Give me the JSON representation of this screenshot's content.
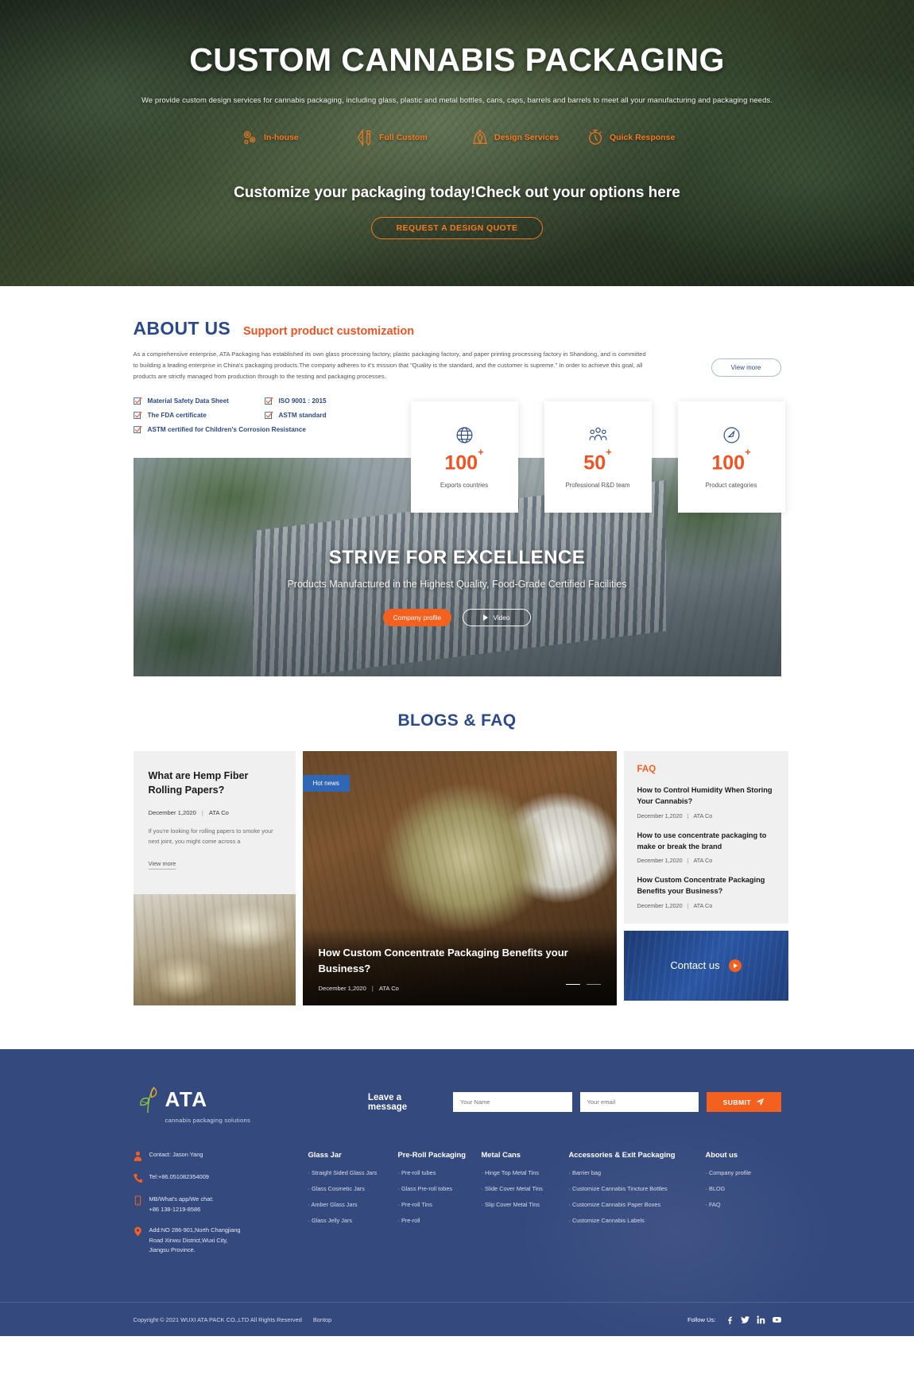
{
  "hero": {
    "title": "CUSTOM CANNABIS PACKAGING",
    "subtitle": "We provide custom design services for cannabis packaging, including glass, plastic and metal bottles, cans, caps, barrels and barrels to meet all your manufacturing and packaging needs.",
    "features": [
      {
        "icon": "gears-icon",
        "label": "In-house"
      },
      {
        "icon": "pencil-ruler-icon",
        "label": "Full Custom"
      },
      {
        "icon": "pen-nib-icon",
        "label": "Design Services"
      },
      {
        "icon": "stopwatch-icon",
        "label": "Quick Response"
      }
    ],
    "cta_title": "Customize your packaging today!Check out your options here",
    "cta_button": "REQUEST A DESIGN QUOTE"
  },
  "about": {
    "title": "ABOUT US",
    "kicker": "Support product customization",
    "paragraph": "As a comprehensive enterprise, ATA Packaging has established its own glass processing factory, plastic packaging factory, and paper printing processing factory in Shandong, and is committed to building a leading enterprise in China's packaging products.The company adheres to it's mission that \"Quality is the standard, and the customer is supreme.\"  In order to achieve this goal, all products are strictly managed from production through to the testing and packaging processes.",
    "view_more": "View more",
    "certs": [
      "Material Safety Data Sheet",
      "ISO 9001 : 2015",
      "The FDA certificate",
      "ASTM standard",
      "ASTM certified for Children's Corrosion Resistance"
    ],
    "stats": [
      {
        "icon": "globe-icon",
        "number": "100",
        "sup": "+",
        "label": "Exports countries"
      },
      {
        "icon": "people-icon",
        "number": "50",
        "sup": "+",
        "label": "Professional R&D team"
      },
      {
        "icon": "tag-icon",
        "number": "100",
        "sup": "+",
        "label": "Product categories"
      }
    ]
  },
  "banner": {
    "title": "STRIVE FOR EXCELLENCE",
    "subtitle": "Products Manufactured in the Highest Quality, Food-Grade Certified Facilities",
    "profile_button": "Company profile",
    "video_button": "Video"
  },
  "blogs": {
    "section_title": "BLOGS & FAQ",
    "left": {
      "title": "What are Hemp Fiber Rolling Papers?",
      "date": "December 1,2020",
      "author": "ATA Co",
      "excerpt": "If you're looking for rolling papers to smoke your next joint, you might come across a",
      "view_more": "View more"
    },
    "center": {
      "badge": "Hot news",
      "title": "How Custom Concentrate Packaging Benefits your Business?",
      "date": "December 1,2020",
      "author": "ATA Co"
    },
    "faq": {
      "title": "FAQ",
      "items": [
        {
          "question": "How to Control Humidity When Storing Your Cannabis?",
          "date": "December 1,2020",
          "author": "ATA Co"
        },
        {
          "question": "How to use concentrate packaging to make or break the brand",
          "date": "December 1,2020",
          "author": "ATA Co"
        },
        {
          "question": "How Custom Concentrate Packaging Benefits your Business?",
          "date": "December 1,2020",
          "author": "ATA Co"
        }
      ]
    },
    "contact_cta": "Contact us"
  },
  "footer": {
    "logo_text": "ATA",
    "logo_tagline": "cannabis  packaging solutions",
    "message_label": "Leave a message",
    "name_placeholder": "Your Name",
    "email_placeholder": "Your email",
    "submit_label": "SUBMIT",
    "contact": [
      {
        "icon": "person-icon",
        "lines": [
          "Contact: Jason Yang"
        ]
      },
      {
        "icon": "phone-icon",
        "lines": [
          "Tel:+86.051082354009"
        ]
      },
      {
        "icon": "mobile-icon",
        "lines": [
          "MB/What's app/We chat:",
          "+86 138-1219-8586"
        ]
      },
      {
        "icon": "location-icon",
        "lines": [
          "Add:NO 286-901,North Changjiang",
          "Road Xinwu District,Wuxi City,",
          "Jiangsu Province."
        ]
      }
    ],
    "columns": [
      {
        "title": "Glass Jar",
        "items": [
          "· Straight Sided Glass Jars",
          "· Glass Cosmetic Jars",
          "· Amber Glass Jars",
          "· Glass Jelly Jars"
        ]
      },
      {
        "title": "Pre-Roll Packaging",
        "items": [
          "· Pre-roll tubes",
          "· Glass Pre-roll tobes",
          "· Pre-roll Tins",
          "· Pre-roll"
        ]
      },
      {
        "title": "Metal Cans",
        "items": [
          "· Hinge Top Metal Tins",
          "· Slide Cover Metal Tins",
          "· Slip Cover Metal Tins"
        ]
      },
      {
        "title": "Accessories & Exit Packaging",
        "items": [
          "· Barrier bag",
          "· Customize Cannabis Tincture Bottles",
          "· Customize Cannabis Paper Boxes",
          "· Customize Cannabis Labels"
        ]
      },
      {
        "title": "About us",
        "items": [
          "· Company profile",
          "· BLOG",
          "· FAQ"
        ]
      }
    ],
    "copyright": "Copyright © 2021 WUXI ATA PACK CO.,LTD All Rights Reserved",
    "bontop": "Bontop",
    "follow_label": "Follow Us:",
    "socials": [
      "facebook-icon",
      "twitter-icon",
      "linkedin-icon",
      "youtube-icon"
    ]
  },
  "colors": {
    "accent_orange": "#f4601e",
    "brand_blue": "#2b4a8b",
    "footer_blue": "#34497e"
  }
}
